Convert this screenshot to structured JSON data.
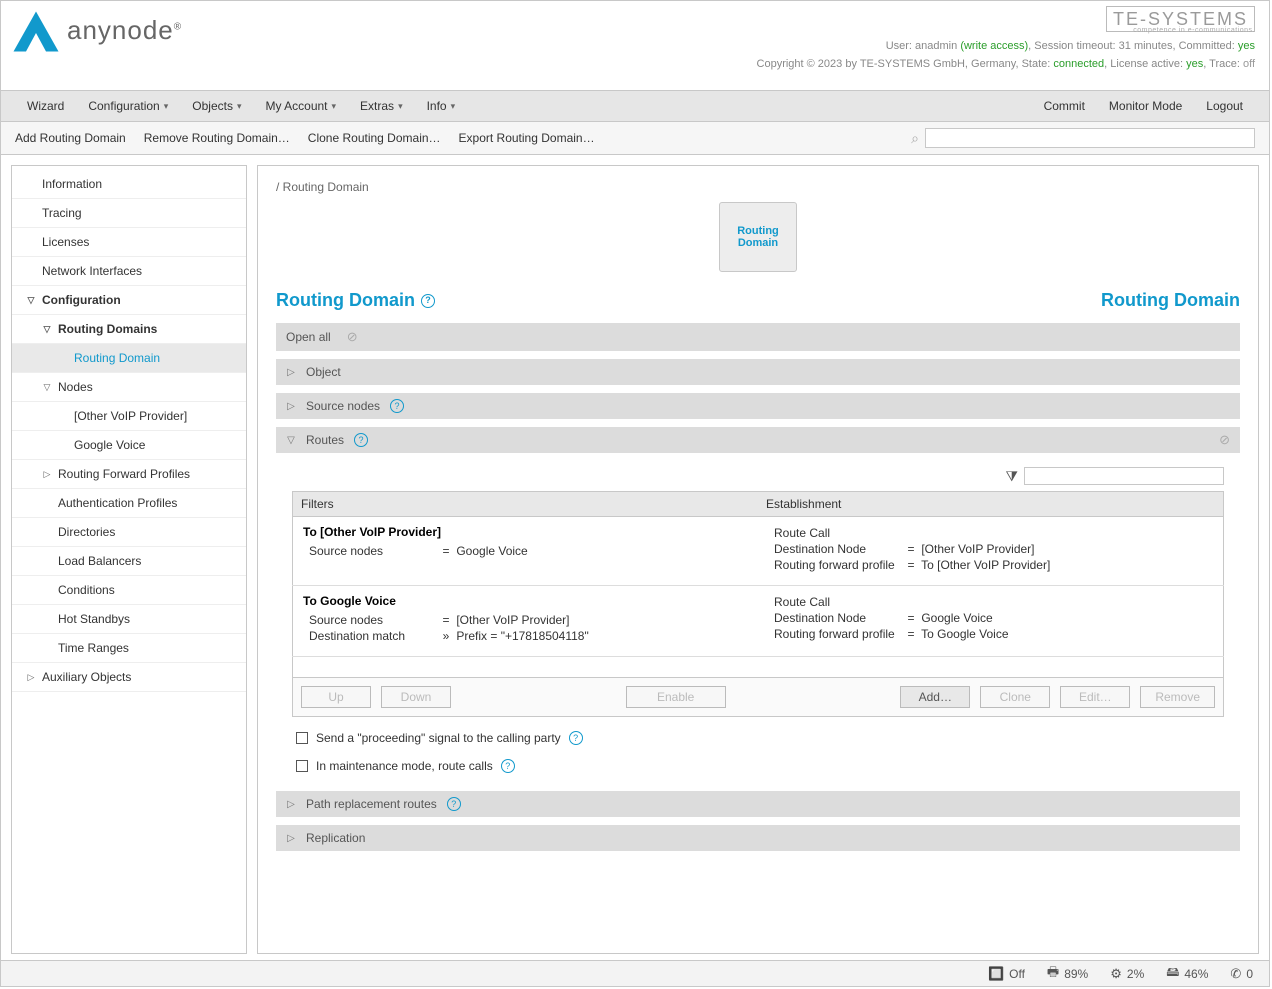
{
  "brand": {
    "name": "anynode",
    "reg": "®",
    "vendor_name": "TE-SYSTEMS",
    "vendor_sub": "competence in e-communications."
  },
  "header": {
    "user_prefix": "User: ",
    "user": "anadmin",
    "access": "(write access)",
    "timeout_label": ", Session timeout: ",
    "timeout": "31 minutes",
    "committed_label": ", Committed: ",
    "committed": "yes",
    "copyright": "Copyright © 2023 by TE-SYSTEMS GmbH, Germany, State: ",
    "state": "connected",
    "license_label": ", License active: ",
    "license": "yes",
    "trace_label": ", Trace: ",
    "trace": "off"
  },
  "menu": {
    "wizard": "Wizard",
    "configuration": "Configuration",
    "objects": "Objects",
    "my_account": "My Account",
    "extras": "Extras",
    "info": "Info",
    "commit": "Commit",
    "monitor_mode": "Monitor Mode",
    "logout": "Logout"
  },
  "toolbar": {
    "add": "Add Routing Domain",
    "remove": "Remove Routing Domain…",
    "clone": "Clone Routing Domain…",
    "export": "Export Routing Domain…"
  },
  "sidebar": {
    "information": "Information",
    "tracing": "Tracing",
    "licenses": "Licenses",
    "network_if": "Network Interfaces",
    "configuration": "Configuration",
    "routing_domains": "Routing Domains",
    "routing_domain": "Routing Domain",
    "nodes": "Nodes",
    "other_voip": "[Other VoIP Provider]",
    "google_voice": "Google Voice",
    "rfp": "Routing Forward Profiles",
    "auth_profiles": "Authentication Profiles",
    "directories": "Directories",
    "load_balancers": "Load Balancers",
    "conditions": "Conditions",
    "hot_standbys": "Hot Standbys",
    "time_ranges": "Time Ranges",
    "aux_objects": "Auxiliary Objects"
  },
  "content": {
    "breadcrumb": "/ Routing Domain",
    "block_line1": "Routing",
    "block_line2": "Domain",
    "title": "Routing Domain",
    "title_right": "Routing Domain",
    "open_all": "Open all",
    "panel_object": "Object",
    "panel_source_nodes": "Source nodes",
    "panel_routes": "Routes",
    "panel_path_repl": "Path replacement routes",
    "panel_replication": "Replication",
    "routes_table": {
      "col_filters": "Filters",
      "col_establishment": "Establishment",
      "rows": [
        {
          "title": "To [Other VoIP Provider]",
          "filter_source_k": "Source nodes",
          "filter_source_v": "Google Voice",
          "est_route_call": "Route Call",
          "est_dest_k": "Destination Node",
          "est_dest_v": "[Other VoIP Provider]",
          "est_rfp_k": "Routing forward profile",
          "est_rfp_v": "To [Other VoIP Provider]"
        },
        {
          "title": "To Google Voice",
          "filter_source_k": "Source nodes",
          "filter_source_v": "[Other VoIP Provider]",
          "filter_dest_k": "Destination match",
          "filter_dest_sep": "»",
          "filter_dest_v": "Prefix = \"+17818504118\"",
          "est_route_call": "Route Call",
          "est_dest_k": "Destination Node",
          "est_dest_v": "Google Voice",
          "est_rfp_k": "Routing forward profile",
          "est_rfp_v": "To Google Voice"
        }
      ]
    },
    "buttons": {
      "up": "Up",
      "down": "Down",
      "enable": "Enable",
      "add": "Add…",
      "clone": "Clone",
      "edit": "Edit…",
      "remove": "Remove"
    },
    "cb_proceeding": "Send a \"proceeding\" signal to the calling party",
    "cb_maintenance": "In maintenance mode, route calls"
  },
  "status": {
    "battery": "Off",
    "printer": "89%",
    "cpu": "2%",
    "storage": "46%",
    "calls": "0"
  }
}
